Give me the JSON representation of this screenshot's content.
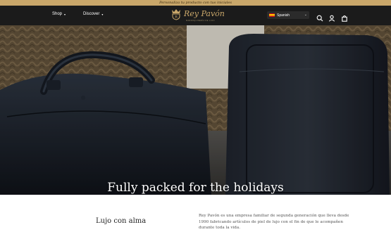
{
  "announcement": {
    "text": "Personaliza tu producto con tus iniciales"
  },
  "nav": {
    "shop_label": "Shop",
    "discover_label": "Discover",
    "caret": "▾"
  },
  "brand": {
    "name": "Rey Pavón",
    "tagline": "MARROQUINERÍA DE LUJO"
  },
  "language": {
    "label": "Spanish",
    "chevron": "⌄"
  },
  "icons": {
    "search": "search-icon",
    "account": "user-icon",
    "cart": "bag-icon"
  },
  "hero": {
    "title": "Fully packed for the holidays",
    "slides": 2,
    "active_slide": 1
  },
  "about": {
    "title": "Lujo con alma",
    "body": "Rey Pavón es una empresa familiar de segunda generación que lleva desde 1990 fabricando artículos de piel de lujo con el fin de que le acompañen durante toda la vida."
  },
  "colors": {
    "gold": "#c9a76a",
    "nav_bg": "#1b1b1b",
    "hero_bg": "#3a3a38"
  }
}
